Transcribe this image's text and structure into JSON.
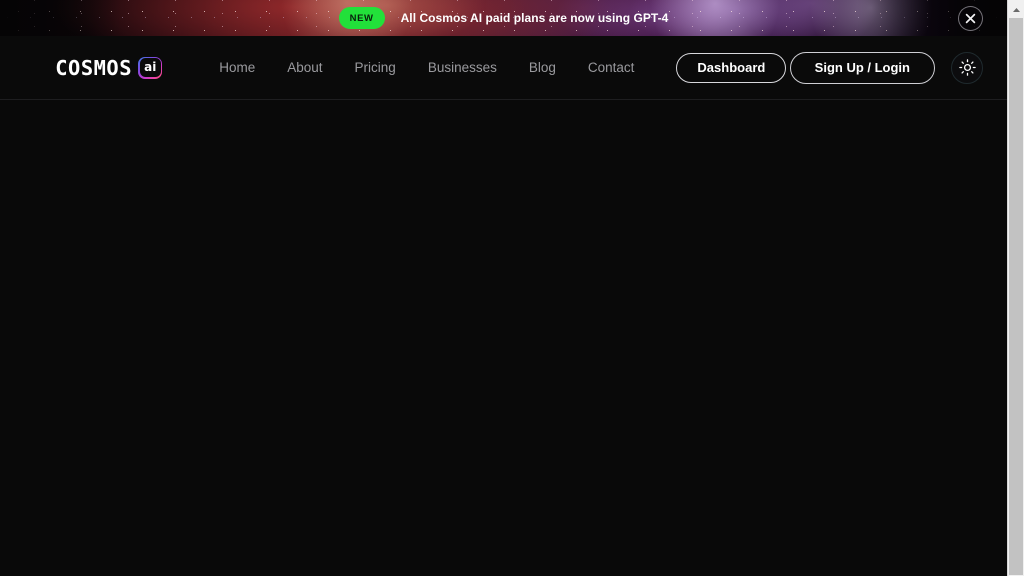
{
  "banner": {
    "badge_label": "NEW",
    "message": "All Cosmos AI paid plans are now using GPT-4",
    "close_icon": "close-icon",
    "badge_color": "#22e03a",
    "text_color": "#ffffff"
  },
  "navbar": {
    "logo": {
      "word": "COSMOS",
      "badge": "ai",
      "badge_gradient": "#3b7de8 -> #7b4be0 -> #c43ad0 -> #f0449a"
    },
    "links": [
      {
        "label": "Home"
      },
      {
        "label": "About"
      },
      {
        "label": "Pricing"
      },
      {
        "label": "Businesses"
      },
      {
        "label": "Blog"
      },
      {
        "label": "Contact"
      }
    ],
    "dashboard_label": "Dashboard",
    "signup_label": "Sign Up / Login",
    "theme_toggle_icon": "sun-icon",
    "link_color": "#9a9a9e",
    "background": "#0a0a0a"
  },
  "page": {
    "background": "#090909",
    "content": ""
  },
  "scrollbar": {
    "up_arrow_icon": "scroll-up-arrow-icon",
    "thumb_color": "#c2c2c2",
    "track_color": "#f0f0f0"
  }
}
